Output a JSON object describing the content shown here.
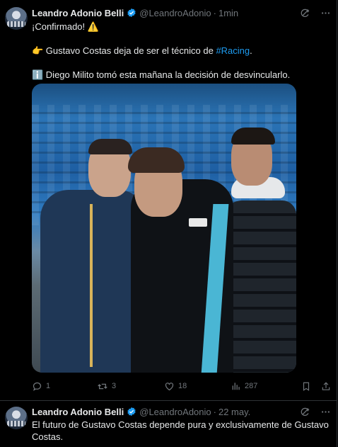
{
  "tweets": [
    {
      "author": "Leandro Adonio Belli",
      "handle": "@LeandroAdonio",
      "time": "1min",
      "lines": [
        {
          "parts": [
            "¡Confirmado! ",
            "⚠️"
          ]
        },
        {
          "parts": [
            "👉 Gustavo Costas deja de ser el técnico de ",
            "#Racing",
            "."
          ]
        },
        {
          "parts": [
            "ℹ️ Diego Milito tomó esta mañana la decisión de desvincularlo."
          ]
        }
      ],
      "stats": {
        "replies": "1",
        "reposts": "3",
        "likes": "18",
        "views": "287"
      }
    },
    {
      "author": "Leandro Adonio Belli",
      "handle": "@LeandroAdonio",
      "time": "22 may.",
      "text": "El futuro de Gustavo Costas depende pura y exclusivamente de Gustavo Costas."
    }
  ],
  "icons": {
    "verified": "verified-badge-icon",
    "grok": "grok-icon",
    "more": "more-icon",
    "reply": "reply-icon",
    "repost": "repost-icon",
    "like": "like-icon",
    "views": "views-icon",
    "bookmark": "bookmark-icon",
    "share": "share-icon"
  },
  "colors": {
    "background": "#000000",
    "text": "#e7e9ea",
    "muted": "#71767b",
    "link": "#1d9bf0",
    "verified": "#1d9bf0"
  }
}
